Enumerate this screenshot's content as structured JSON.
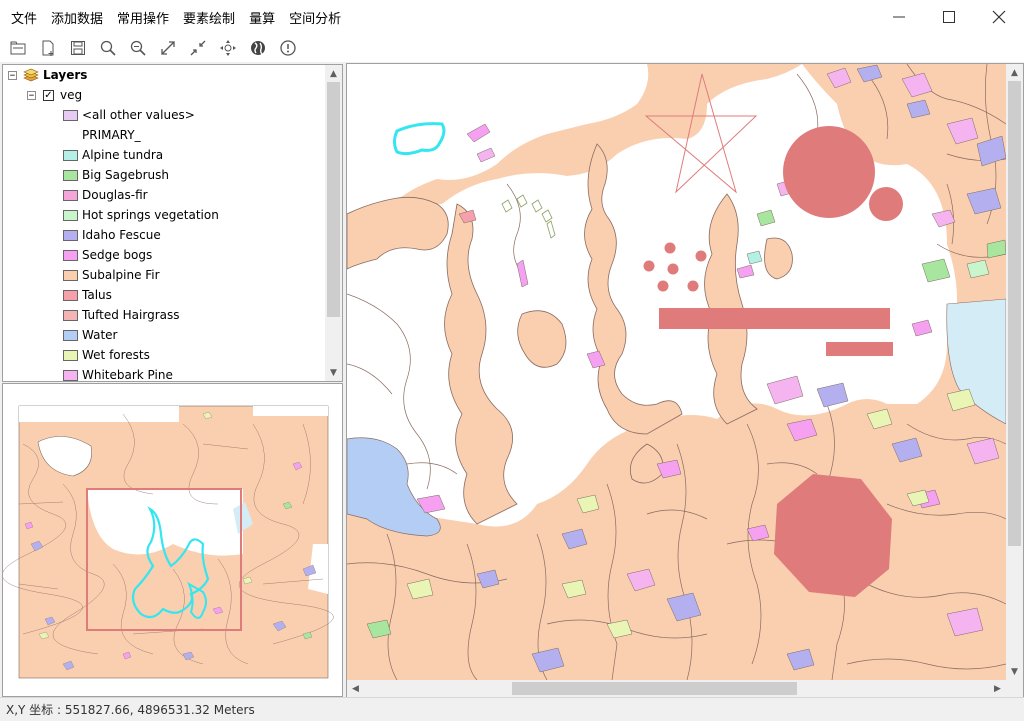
{
  "menu": [
    {
      "label": "文件"
    },
    {
      "label": "添加数据"
    },
    {
      "label": "常用操作"
    },
    {
      "label": "要素绘制"
    },
    {
      "label": "量算"
    },
    {
      "label": "空间分析"
    }
  ],
  "window_controls": {
    "minimize_icon": "minimize-icon",
    "maximize_icon": "maximize-icon",
    "close_icon": "close-icon"
  },
  "toolbar": [
    {
      "name": "open-icon"
    },
    {
      "name": "new-doc-icon"
    },
    {
      "name": "save-icon"
    },
    {
      "name": "zoom-in-icon"
    },
    {
      "name": "zoom-out-icon"
    },
    {
      "name": "full-extent-icon"
    },
    {
      "name": "fixed-zoom-icon"
    },
    {
      "name": "pan-icon"
    },
    {
      "name": "globe-icon"
    },
    {
      "name": "info-icon"
    }
  ],
  "toc": {
    "root_label": "Layers",
    "layer": {
      "name": "veg",
      "checked": true
    },
    "legend": [
      {
        "label": "<all other values>",
        "color": "#e6ccf5"
      },
      {
        "label": "PRIMARY_",
        "color": null
      },
      {
        "label": "Alpine tundra",
        "color": "#b4f0e6"
      },
      {
        "label": "Big Sagebrush",
        "color": "#a8e6a0"
      },
      {
        "label": "Douglas-fir",
        "color": "#f5a6d8"
      },
      {
        "label": "Hot springs vegetation",
        "color": "#c8f5cc"
      },
      {
        "label": "Idaho Fescue",
        "color": "#b4b0f0"
      },
      {
        "label": "Sedge bogs",
        "color": "#f5a0f0"
      },
      {
        "label": "Subalpine Fir",
        "color": "#facfb0"
      },
      {
        "label": "Talus",
        "color": "#f5a0aa"
      },
      {
        "label": "Tufted Hairgrass",
        "color": "#f5b4b4"
      },
      {
        "label": "Water",
        "color": "#b4cdf5"
      },
      {
        "label": "Wet forests",
        "color": "#e8f5b4"
      },
      {
        "label": "Whitebark Pine",
        "color": "#f5b4f0"
      }
    ]
  },
  "status": {
    "text": "X,Y 坐标 : 551827.66, 4896531.32  Meters"
  },
  "colors": {
    "accent": "#e07b7b",
    "base": "#facfb0",
    "cyan": "#33e6f0"
  }
}
